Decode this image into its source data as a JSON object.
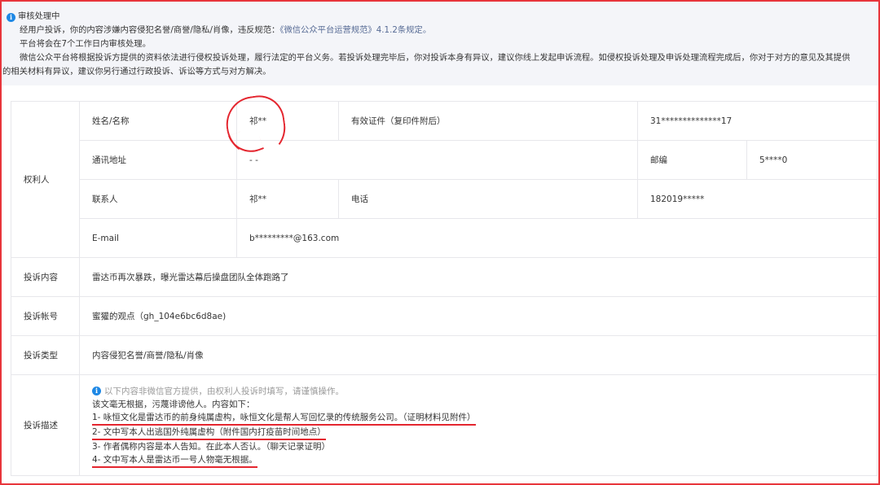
{
  "notice": {
    "title": "审核处理中",
    "line1_prefix": "经用户投诉，你的内容涉嫌内容侵犯名誉/商誉/隐私/肖像，违反规范：",
    "line1_link": "《微信公众平台运营规范》4.1.2条规定。",
    "line2": "平台将会在7个工作日内审核处理。",
    "line3": "微信公众平台将根据投诉方提供的资料依法进行侵权投诉处理，履行法定的平台义务。若投诉处理完毕后，你对投诉本身有异议，建议你线上发起申诉流程。如侵权投诉处理及申诉处理流程完成后，你对于对方的意见及其提供",
    "line4": "的相关材料有异议，建议你另行通过行政投诉、诉讼等方式与对方解决。"
  },
  "rights_holder": {
    "section_label": "权利人",
    "name_label": "姓名/名称",
    "name_value": "祁**",
    "id_label": "有效证件（复印件附后）",
    "id_value": "31**************17",
    "address_label": "通讯地址",
    "address_value": "- -",
    "zip_label": "邮编",
    "zip_value": "5****0",
    "contact_label": "联系人",
    "contact_value": "祁**",
    "phone_label": "电话",
    "phone_value": "182019*****",
    "email_label": "E-mail",
    "email_value": "b*********@163.com"
  },
  "complaint": {
    "content_label": "投诉内容",
    "content_value": "雷达币再次暴跌，曝光雷达幕后操盘团队全体跑路了",
    "account_label": "投诉帐号",
    "account_value": "蜜獾的观点（gh_104e6bc6d8ae)",
    "type_label": "投诉类型",
    "type_value": "内容侵犯名誉/商誉/隐私/肖像",
    "desc_label": "投诉描述",
    "desc_tip": "以下内容非微信官方提供，由权利人投诉时填写，请谨慎操作。",
    "desc_intro1": "该文毫无根据，污蔑诽谤他人。内容如下：",
    "desc_items": [
      "1- 咏恒文化是雷达币的前身纯属虚构，咏恒文化是帮人写回忆录的传统服务公司。（证明材料见附件）",
      "2- 文中写本人出逃国外纯属虚构（附件国内打疫苗时间地点）",
      "3- 作者偶称内容是本人告知。在此本人否认。（聊天记录证明）",
      "4- 文中写本人是雷达币一号人物毫无根据。"
    ]
  },
  "colors": {
    "frame_red": "#e8353b",
    "annotation_red": "#e4262f",
    "info_blue": "#1e88e5",
    "link_blue": "#576b95"
  },
  "icons": [
    "info-icon"
  ]
}
